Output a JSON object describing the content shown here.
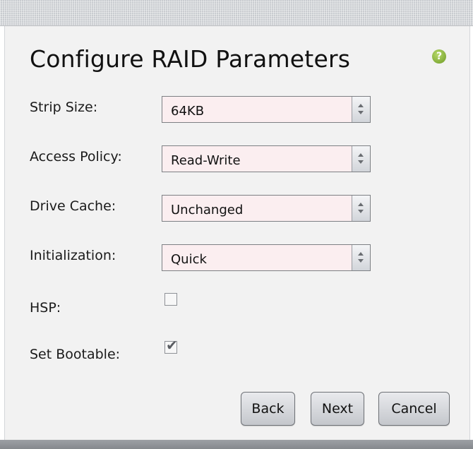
{
  "dialog": {
    "title": "Configure RAID Parameters",
    "help_symbol": "?"
  },
  "fields": {
    "strip_size": {
      "label": "Strip Size:",
      "value": "64KB"
    },
    "access_policy": {
      "label": "Access Policy:",
      "value": "Read-Write"
    },
    "drive_cache": {
      "label": "Drive Cache:",
      "value": "Unchanged"
    },
    "initialization": {
      "label": "Initialization:",
      "value": "Quick"
    },
    "hsp": {
      "label": "HSP:",
      "checked": false
    },
    "set_bootable": {
      "label": "Set Bootable:",
      "checked": true
    }
  },
  "buttons": {
    "back": "Back",
    "next": "Next",
    "cancel": "Cancel"
  },
  "colors": {
    "select_background": "#fbeef0",
    "help_icon": "#7fae2e",
    "panel_background": "#f2f2f2"
  }
}
